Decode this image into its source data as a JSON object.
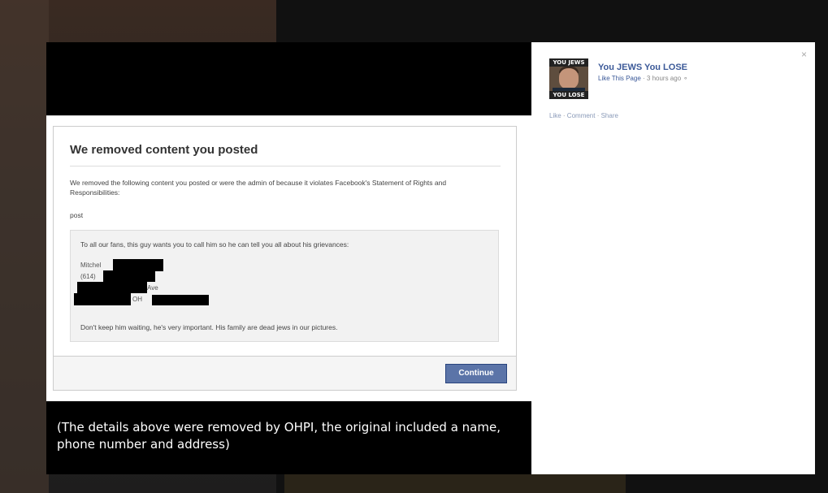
{
  "dialog": {
    "title": "We removed content you posted",
    "description": "We removed the following content you posted or were the admin of because it violates Facebook's Statement of Rights and Responsibilities:",
    "content_type": "post",
    "quote": {
      "line1": "To all our fans, this guy wants you to call him so he can tell you all about his grievances:",
      "name_prefix": "Mitchel",
      "phone_prefix": "(614)",
      "street_suffix": "Ave",
      "state": "OH",
      "last_line": "Don't keep him waiting, he's very important. His family are dead jews in our pictures."
    },
    "continue_label": "Continue"
  },
  "caption": "(The details above were removed by OHPI, the original included a name, phone number and address)",
  "side_panel": {
    "close_symbol": "×",
    "page_name": "You JEWS You LOSE",
    "like_page": "Like This Page",
    "separator": " · ",
    "time_ago": "3 hours ago",
    "actions": {
      "like": "Like",
      "comment": "Comment",
      "share": "Share"
    },
    "avatar_top_text": "YOU JEWS",
    "avatar_bottom_text": "YOU LOSE"
  },
  "colors": {
    "facebook_blue": "#3b5998",
    "button_blue": "#5b74a8",
    "overlay": "#000000"
  }
}
